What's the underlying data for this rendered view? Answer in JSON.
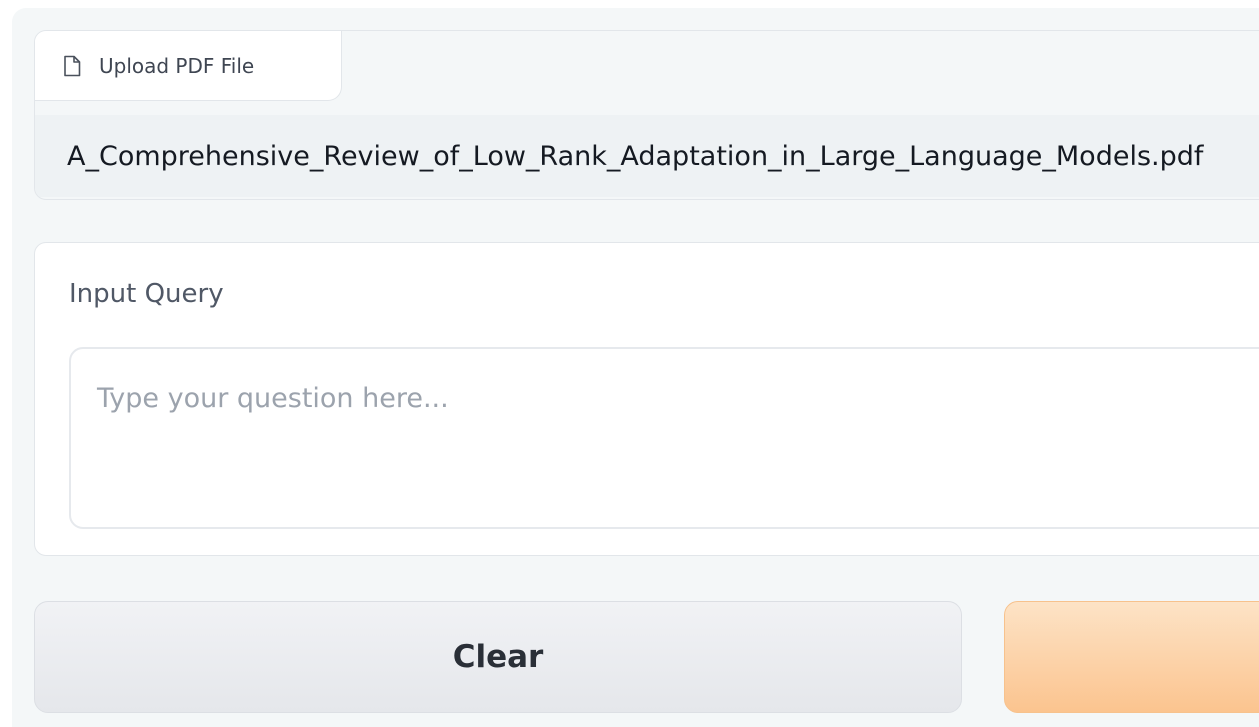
{
  "upload": {
    "tab_label": "Upload PDF File",
    "icon": "file-icon",
    "file_name": "A_Comprehensive_Review_of_Low_Rank_Adaptation_in_Large_Language_Models.pdf"
  },
  "query": {
    "label": "Input Query",
    "value": "",
    "placeholder": "Type your question here..."
  },
  "buttons": {
    "clear_label": "Clear",
    "submit_label": ""
  },
  "colors": {
    "panel_bg": "#f4f7f8",
    "clear_button": "#e5e7eb",
    "submit_button": "#fbc48f"
  }
}
